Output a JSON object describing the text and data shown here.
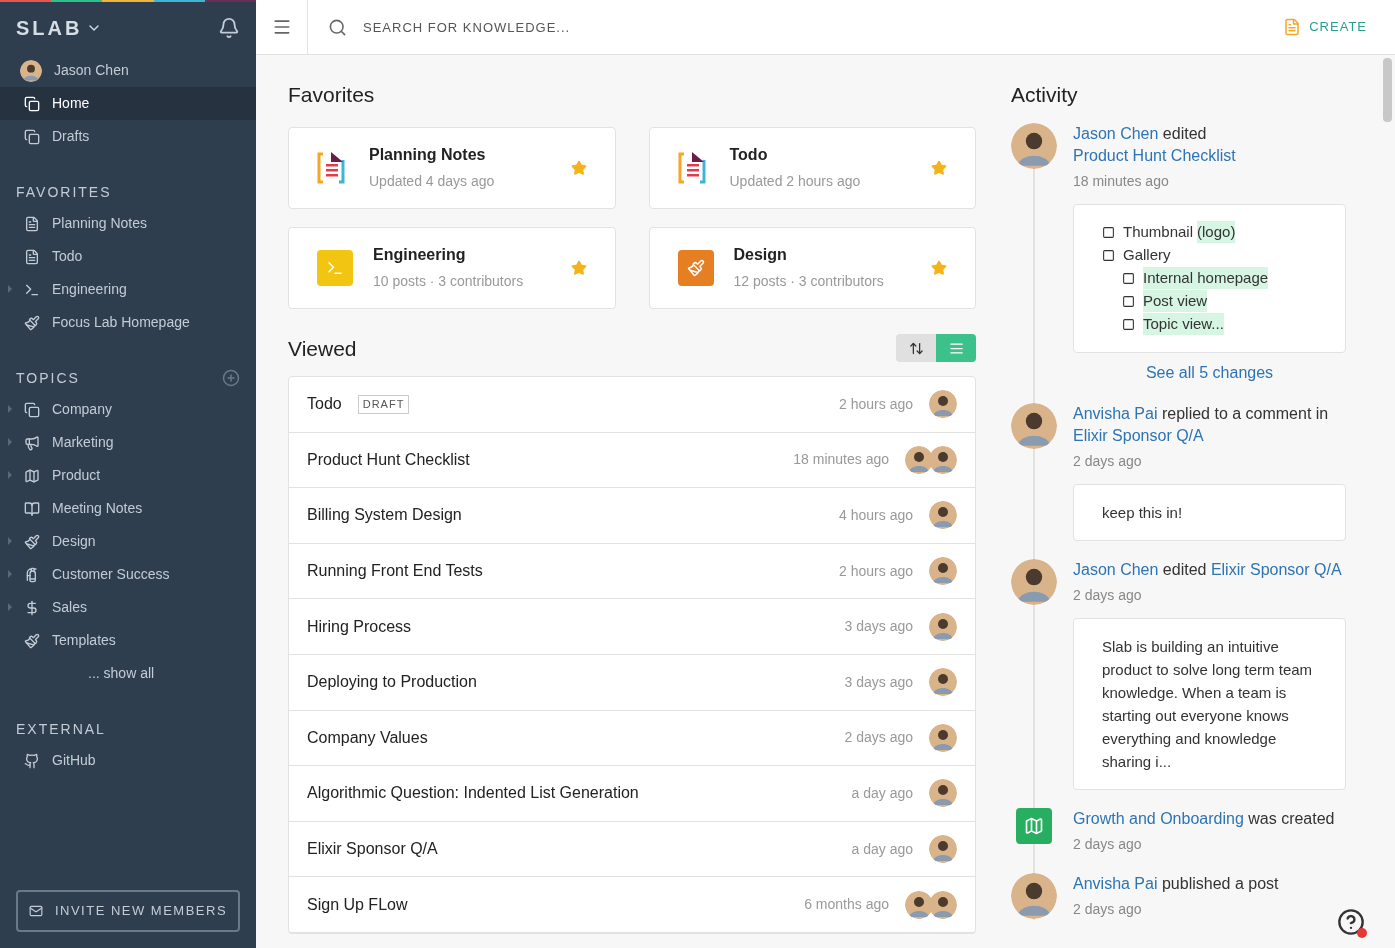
{
  "sidebar": {
    "brand": "SLAB",
    "user": {
      "name": "Jason Chen"
    },
    "nav": [
      {
        "label": "Home",
        "kind": "pages",
        "selected": true
      },
      {
        "label": "Drafts",
        "kind": "pages",
        "selected": false
      }
    ],
    "sections": [
      {
        "title": "FAVORITES",
        "add": false,
        "items": [
          {
            "label": "Planning Notes",
            "kind": "document",
            "expandable": false
          },
          {
            "label": "Todo",
            "kind": "document",
            "expandable": false
          },
          {
            "label": "Engineering",
            "kind": "terminal",
            "expandable": true
          },
          {
            "label": "Focus Lab Homepage",
            "kind": "brush",
            "expandable": false
          }
        ]
      },
      {
        "title": "TOPICS",
        "add": true,
        "items": [
          {
            "label": "Company",
            "kind": "pages",
            "expandable": true
          },
          {
            "label": "Marketing",
            "kind": "megaphone",
            "expandable": true
          },
          {
            "label": "Product",
            "kind": "map",
            "expandable": true
          },
          {
            "label": "Meeting Notes",
            "kind": "book",
            "expandable": false
          },
          {
            "label": "Design",
            "kind": "brush",
            "expandable": true
          },
          {
            "label": "Customer Success",
            "kind": "extinguisher",
            "expandable": true
          },
          {
            "label": "Sales",
            "kind": "dollar",
            "expandable": true
          },
          {
            "label": "Templates",
            "kind": "brush",
            "expandable": false
          }
        ],
        "more": "... show all"
      },
      {
        "title": "EXTERNAL",
        "add": false,
        "items": [
          {
            "label": "GitHub",
            "kind": "github",
            "expandable": false
          }
        ]
      }
    ],
    "invite_button": "INVITE NEW MEMBERS"
  },
  "header": {
    "search": {
      "placeholder": "SEARCH FOR KNOWLEDGE..."
    },
    "create_button": "CREATE"
  },
  "favorites": {
    "title": "Favorites",
    "cards": [
      {
        "title": "Planning Notes",
        "subtitle": "Updated 4 days ago",
        "kind": "document",
        "starred": true
      },
      {
        "title": "Todo",
        "subtitle": "Updated 2 hours ago",
        "kind": "document",
        "starred": true
      },
      {
        "title": "Engineering",
        "subtitle": "10 posts · 3 contributors",
        "kind": "terminal",
        "starred": true
      },
      {
        "title": "Design",
        "subtitle": "12 posts · 3 contributors",
        "kind": "brush",
        "starred": true
      }
    ]
  },
  "viewed": {
    "title": "Viewed",
    "view_toggle": [
      {
        "kind": "sort",
        "selected": false
      },
      {
        "kind": "list",
        "selected": true
      }
    ],
    "rows": [
      {
        "title": "Todo",
        "badge": "DRAFT",
        "time": "2 hours ago"
      },
      {
        "title": "Product Hunt Checklist",
        "time": "18 minutes ago"
      },
      {
        "title": "Billing System Design",
        "time": "4 hours ago"
      },
      {
        "title": "Running Front End Tests",
        "time": "2 hours ago"
      },
      {
        "title": "Hiring Process",
        "time": "3 days ago"
      },
      {
        "title": "Deploying to Production",
        "time": "3 days ago"
      },
      {
        "title": "Company Values",
        "time": "2 days ago"
      },
      {
        "title": "Algorithmic Question: Indented List Generation",
        "time": "a day ago"
      },
      {
        "title": "Elixir Sponsor Q/A",
        "time": "a day ago"
      },
      {
        "title": "Sign Up FLow",
        "time": "6 months ago"
      }
    ]
  },
  "activity": {
    "title": "Activity",
    "items": [
      {
        "kind": "user",
        "actor": "Jason Chen",
        "verb": "edited",
        "target": "Product Hunt Checklist",
        "time": "18 minutes ago",
        "detail": {
          "kind": "checklist",
          "items": [
            {
              "checked": false,
              "parts": [
                {
                  "text": "Thumbnail",
                  "added": false
                },
                {
                  "text": "(logo)",
                  "added": true
                }
              ]
            },
            {
              "checked": false,
              "parts": [
                {
                  "text": "Gallery",
                  "added": false
                }
              ],
              "children": [
                {
                  "checked": false,
                  "parts": [
                    {
                      "text": "Internal homepage",
                      "added": true
                    }
                  ]
                },
                {
                  "checked": false,
                  "parts": [
                    {
                      "text": "Post view",
                      "added": true
                    }
                  ]
                },
                {
                  "checked": false,
                  "parts": [
                    {
                      "text": "Topic view...",
                      "added": true
                    }
                  ]
                }
              ]
            }
          ],
          "more": "See all 5 changes"
        }
      },
      {
        "kind": "user",
        "actor": "Anvisha Pai",
        "verb": "replied to a comment in",
        "target": "Elixir Sponsor Q/A",
        "time": "2 days ago",
        "detail": {
          "kind": "text",
          "text": "keep this in!"
        }
      },
      {
        "kind": "user",
        "actor": "Jason Chen",
        "verb": "edited",
        "target": "Elixir Sponsor Q/A",
        "time": "2 days ago",
        "detail": {
          "kind": "text",
          "text": "Slab is building an intuitive product to solve long term team knowledge. When a team is starting out everyone knows everything and knowledge sharing i..."
        }
      },
      {
        "kind": "topic",
        "actor": "Growth and Onboarding",
        "verb": "was created",
        "time": "2 days ago"
      },
      {
        "kind": "user",
        "actor": "Anvisha Pai",
        "verb": "published a post",
        "time": "2 days ago"
      }
    ]
  },
  "help": {
    "unread": true
  }
}
